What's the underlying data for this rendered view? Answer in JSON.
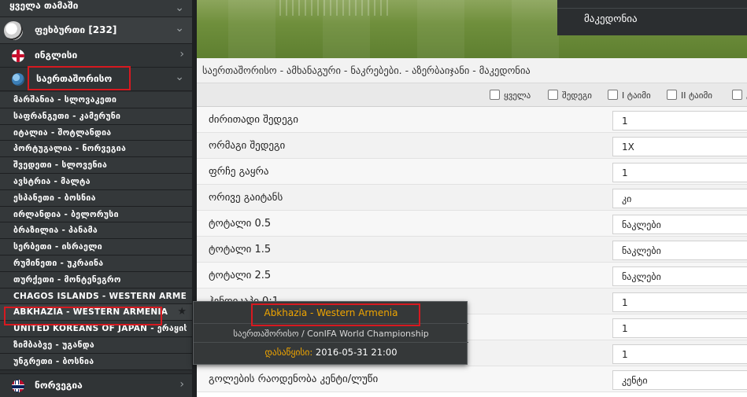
{
  "sidebar": {
    "all_games_label": "ყველა თამაში",
    "sport_label": "ფეხბურთი [232]",
    "countries": [
      {
        "label": "ინგლისი",
        "flag": "england-flag-icon"
      },
      {
        "label": "საერთაშორისო",
        "flag": "globe-icon"
      }
    ],
    "matches": [
      "მარშანია - სლოვაკეთი",
      "საფრანგეთი - კამერუნი",
      "იტალია - შოტლანდია",
      "პორტუგალია - ნორვეგია",
      "შვედეთი - სლოვენია",
      "ავსტრია - მალტა",
      "ესპანეთი - ბოსნია",
      "ირლანდია - ბელორუსი",
      "ბრაზილია - პანამა",
      "სერბეთი - ისრაელი",
      "რუმინეთი - უკრაინა",
      "თურქეთი - მონტენეგრო",
      "CHAGOS ISLANDS - WESTERN ARMENIA",
      "ABKHAZIA - WESTERN ARMENIA",
      "UNITED KOREANS OF JAPAN - ერაყის ქ...",
      "ზიმბაბვე - უგანდა",
      "უნგრეთი - ბოსნია"
    ],
    "norway_label": "ნორვეგია",
    "colors": {
      "background": "#2b2e30",
      "highlight_border": "#d71920"
    }
  },
  "dropdown": {
    "item": "მაკედონია"
  },
  "breadcrumb": "საერთაშორისო - ამხანაგური - ნაკრებები. - აზერბაიჯანი - მაკედონია",
  "filters": [
    "ყველა",
    "შედეგი",
    "I ტაიმი",
    "II ტაიმი",
    "გ"
  ],
  "markets": [
    {
      "label": "ძირითადი შედეგი",
      "value": "1"
    },
    {
      "label": "ორმაგი შედეგი",
      "value": "1X"
    },
    {
      "label": "ფრჩე გაყრა",
      "value": "1"
    },
    {
      "label": "ორივე გაიტანს",
      "value": "კი"
    },
    {
      "label": "ტოტალი 0.5",
      "value": "ნაკლები"
    },
    {
      "label": "ტოტალი 1.5",
      "value": "ნაკლები"
    },
    {
      "label": "ტოტალი 2.5",
      "value": "ნაკლები"
    },
    {
      "label": "ჰენდიკაპი 0:1",
      "value": "1"
    },
    {
      "label": "",
      "value": "1"
    },
    {
      "label": "",
      "value": "1"
    },
    {
      "label": "გოლების რაოდენობა კენტი/ლუწი",
      "value": "კენტი"
    }
  ],
  "tooltip": {
    "title": "Abkhazia - Western Armenia",
    "competition": "საერთაშორისო / ConIFA World Championship",
    "date_label": "დასაწყისი:",
    "date_value": "2016-05-31 21:00",
    "accent": "#f0a500"
  }
}
